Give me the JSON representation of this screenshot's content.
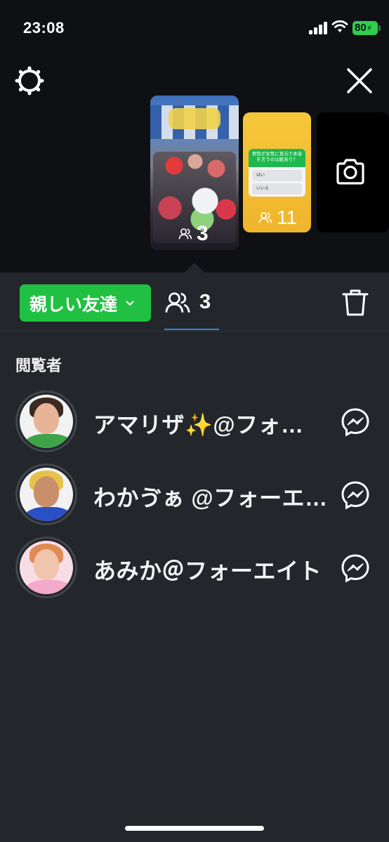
{
  "status_bar": {
    "time": "23:08",
    "battery": "80"
  },
  "story_thumbnails": [
    {
      "kind": "photo",
      "viewer_count": "3"
    },
    {
      "kind": "poll",
      "viewer_count": "11",
      "poll_question": "男性が女性に耳元で本音を言うのは脈あり？",
      "poll_options": [
        "はい",
        "いいえ"
      ]
    },
    {
      "kind": "camera"
    }
  ],
  "toolbar": {
    "audience_label": "親しい友達",
    "viewer_count": "3"
  },
  "viewers_section": {
    "title": "閲覧者",
    "viewers": [
      {
        "name": "アマリザ✨@フォ…"
      },
      {
        "name": "わかゔぁ @フォーエ…"
      },
      {
        "name": "あみか＠フォーエイト"
      }
    ]
  },
  "colors": {
    "accent_green": "#20c142",
    "tab_underline": "#3a86d9",
    "background": "#23262b",
    "top_background": "#0e1014"
  },
  "icons": [
    "gear-icon",
    "close-icon",
    "camera-icon",
    "people-icon",
    "chevron-down-icon",
    "trash-icon",
    "messenger-icon"
  ]
}
